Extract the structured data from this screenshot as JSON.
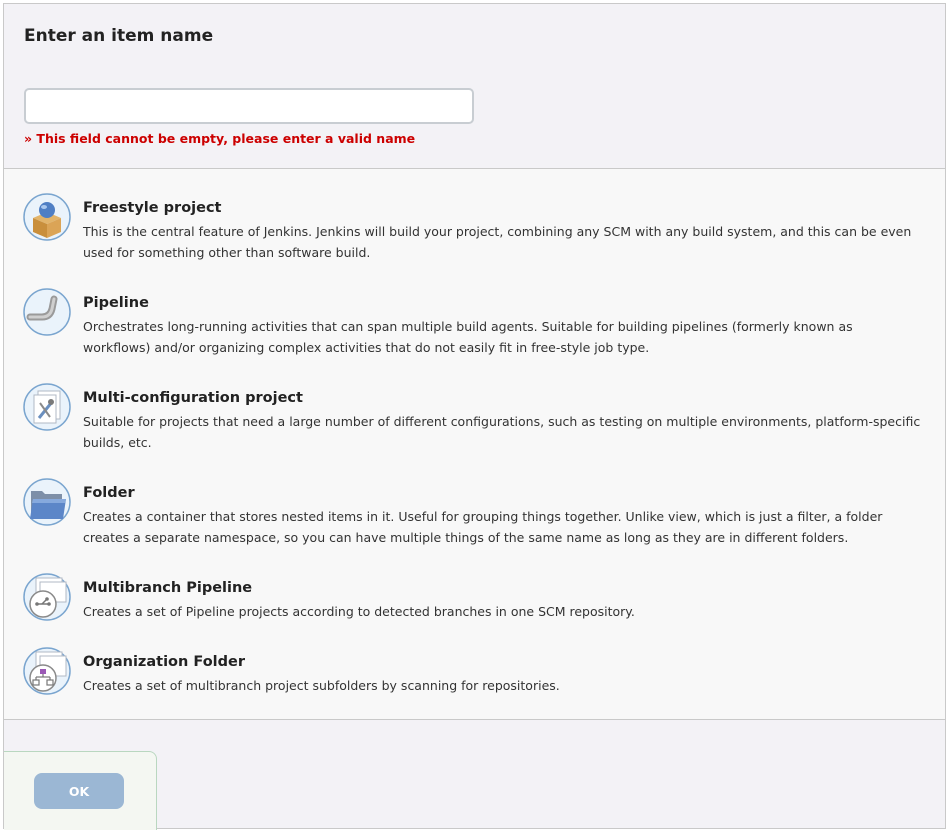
{
  "form": {
    "title": "Enter an item name",
    "name_value": "",
    "name_placeholder": "",
    "error": "» This field cannot be empty, please enter a valid name"
  },
  "item_types": [
    {
      "name": "Freestyle project",
      "description": "This is the central feature of Jenkins. Jenkins will build your project, combining any SCM with any build system, and this can be even used for something other than software build.",
      "icon": "freestyle-project-icon"
    },
    {
      "name": "Pipeline",
      "description": "Orchestrates long-running activities that can span multiple build agents. Suitable for building pipelines (formerly known as workflows) and/or organizing complex activities that do not easily fit in free-style job type.",
      "icon": "pipeline-icon"
    },
    {
      "name": "Multi-configuration project",
      "description": "Suitable for projects that need a large number of different configurations, such as testing on multiple environments, platform-specific builds, etc.",
      "icon": "multi-configuration-icon"
    },
    {
      "name": "Folder",
      "description": "Creates a container that stores nested items in it. Useful for grouping things together. Unlike view, which is just a filter, a folder creates a separate namespace, so you can have multiple things of the same name as long as they are in different folders.",
      "icon": "folder-icon"
    },
    {
      "name": "Multibranch Pipeline",
      "description": "Creates a set of Pipeline projects according to detected branches in one SCM repository.",
      "icon": "multibranch-pipeline-icon"
    },
    {
      "name": "Organization Folder",
      "description": "Creates a set of multibranch project subfolders by scanning for repositories.",
      "icon": "organization-folder-icon"
    }
  ],
  "footer": {
    "ok_label": "OK"
  },
  "colors": {
    "error": "#cc0000",
    "ok_button": "#9bb7d4",
    "header_bg": "#f3f2f6"
  }
}
